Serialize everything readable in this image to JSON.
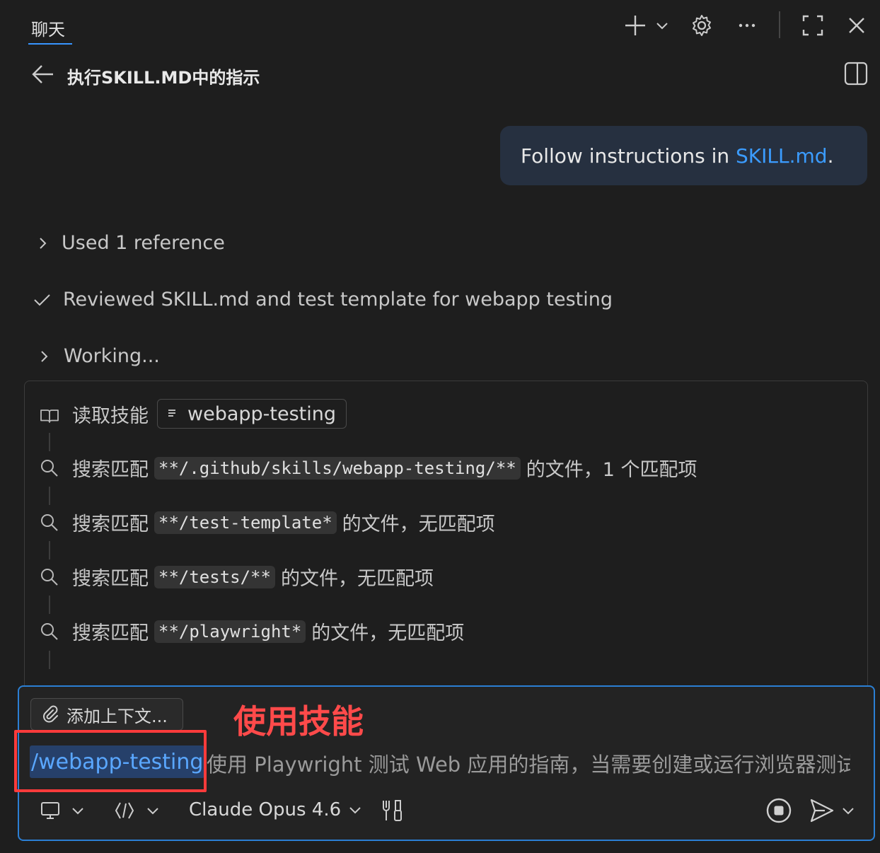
{
  "header": {
    "tab_label": "聊天",
    "icons": [
      "plus-icon",
      "chevron-down-icon",
      "gear-icon",
      "more-icon",
      "maximize-icon",
      "close-icon"
    ]
  },
  "conversation": {
    "title": "执行SKILL.MD中的指示"
  },
  "user_message": {
    "text_prefix": "Follow instructions in ",
    "link_text": "SKILL.md",
    "text_suffix": "."
  },
  "steps": [
    {
      "icon": "chevron-right-icon",
      "text": "Used 1 reference"
    },
    {
      "icon": "check-icon",
      "text": "Reviewed SKILL.md and test template for webapp testing"
    },
    {
      "icon": "chevron-right-icon",
      "text": "Working..."
    }
  ],
  "tool_calls": {
    "read_skill": {
      "label": "读取技能",
      "chip": "webapp-testing"
    },
    "searches": [
      {
        "prefix": "搜索匹配",
        "pattern": "**/.github/skills/webapp-testing/**",
        "suffix": "的文件，1 个匹配项"
      },
      {
        "prefix": "搜索匹配",
        "pattern": "**/test-template*",
        "suffix": "的文件，无匹配项"
      },
      {
        "prefix": "搜索匹配",
        "pattern": "**/tests/**",
        "suffix": "的文件，无匹配项"
      },
      {
        "prefix": "搜索匹配",
        "pattern": "**/playwright*",
        "suffix": "的文件，无匹配项"
      }
    ]
  },
  "input": {
    "add_context_label": "添加上下文...",
    "command": "/webapp-testing",
    "command_description": "使用 Playwright 测试 Web 应用的指南，当需要创建或运行浏览器测试时使用",
    "model_label": "Claude Opus 4.6"
  },
  "annotation": {
    "label": "使用技能",
    "color": "#ff3b3b"
  },
  "colors": {
    "accent": "#3794ff",
    "link": "#3b9cff",
    "background": "#1e1e1e"
  }
}
